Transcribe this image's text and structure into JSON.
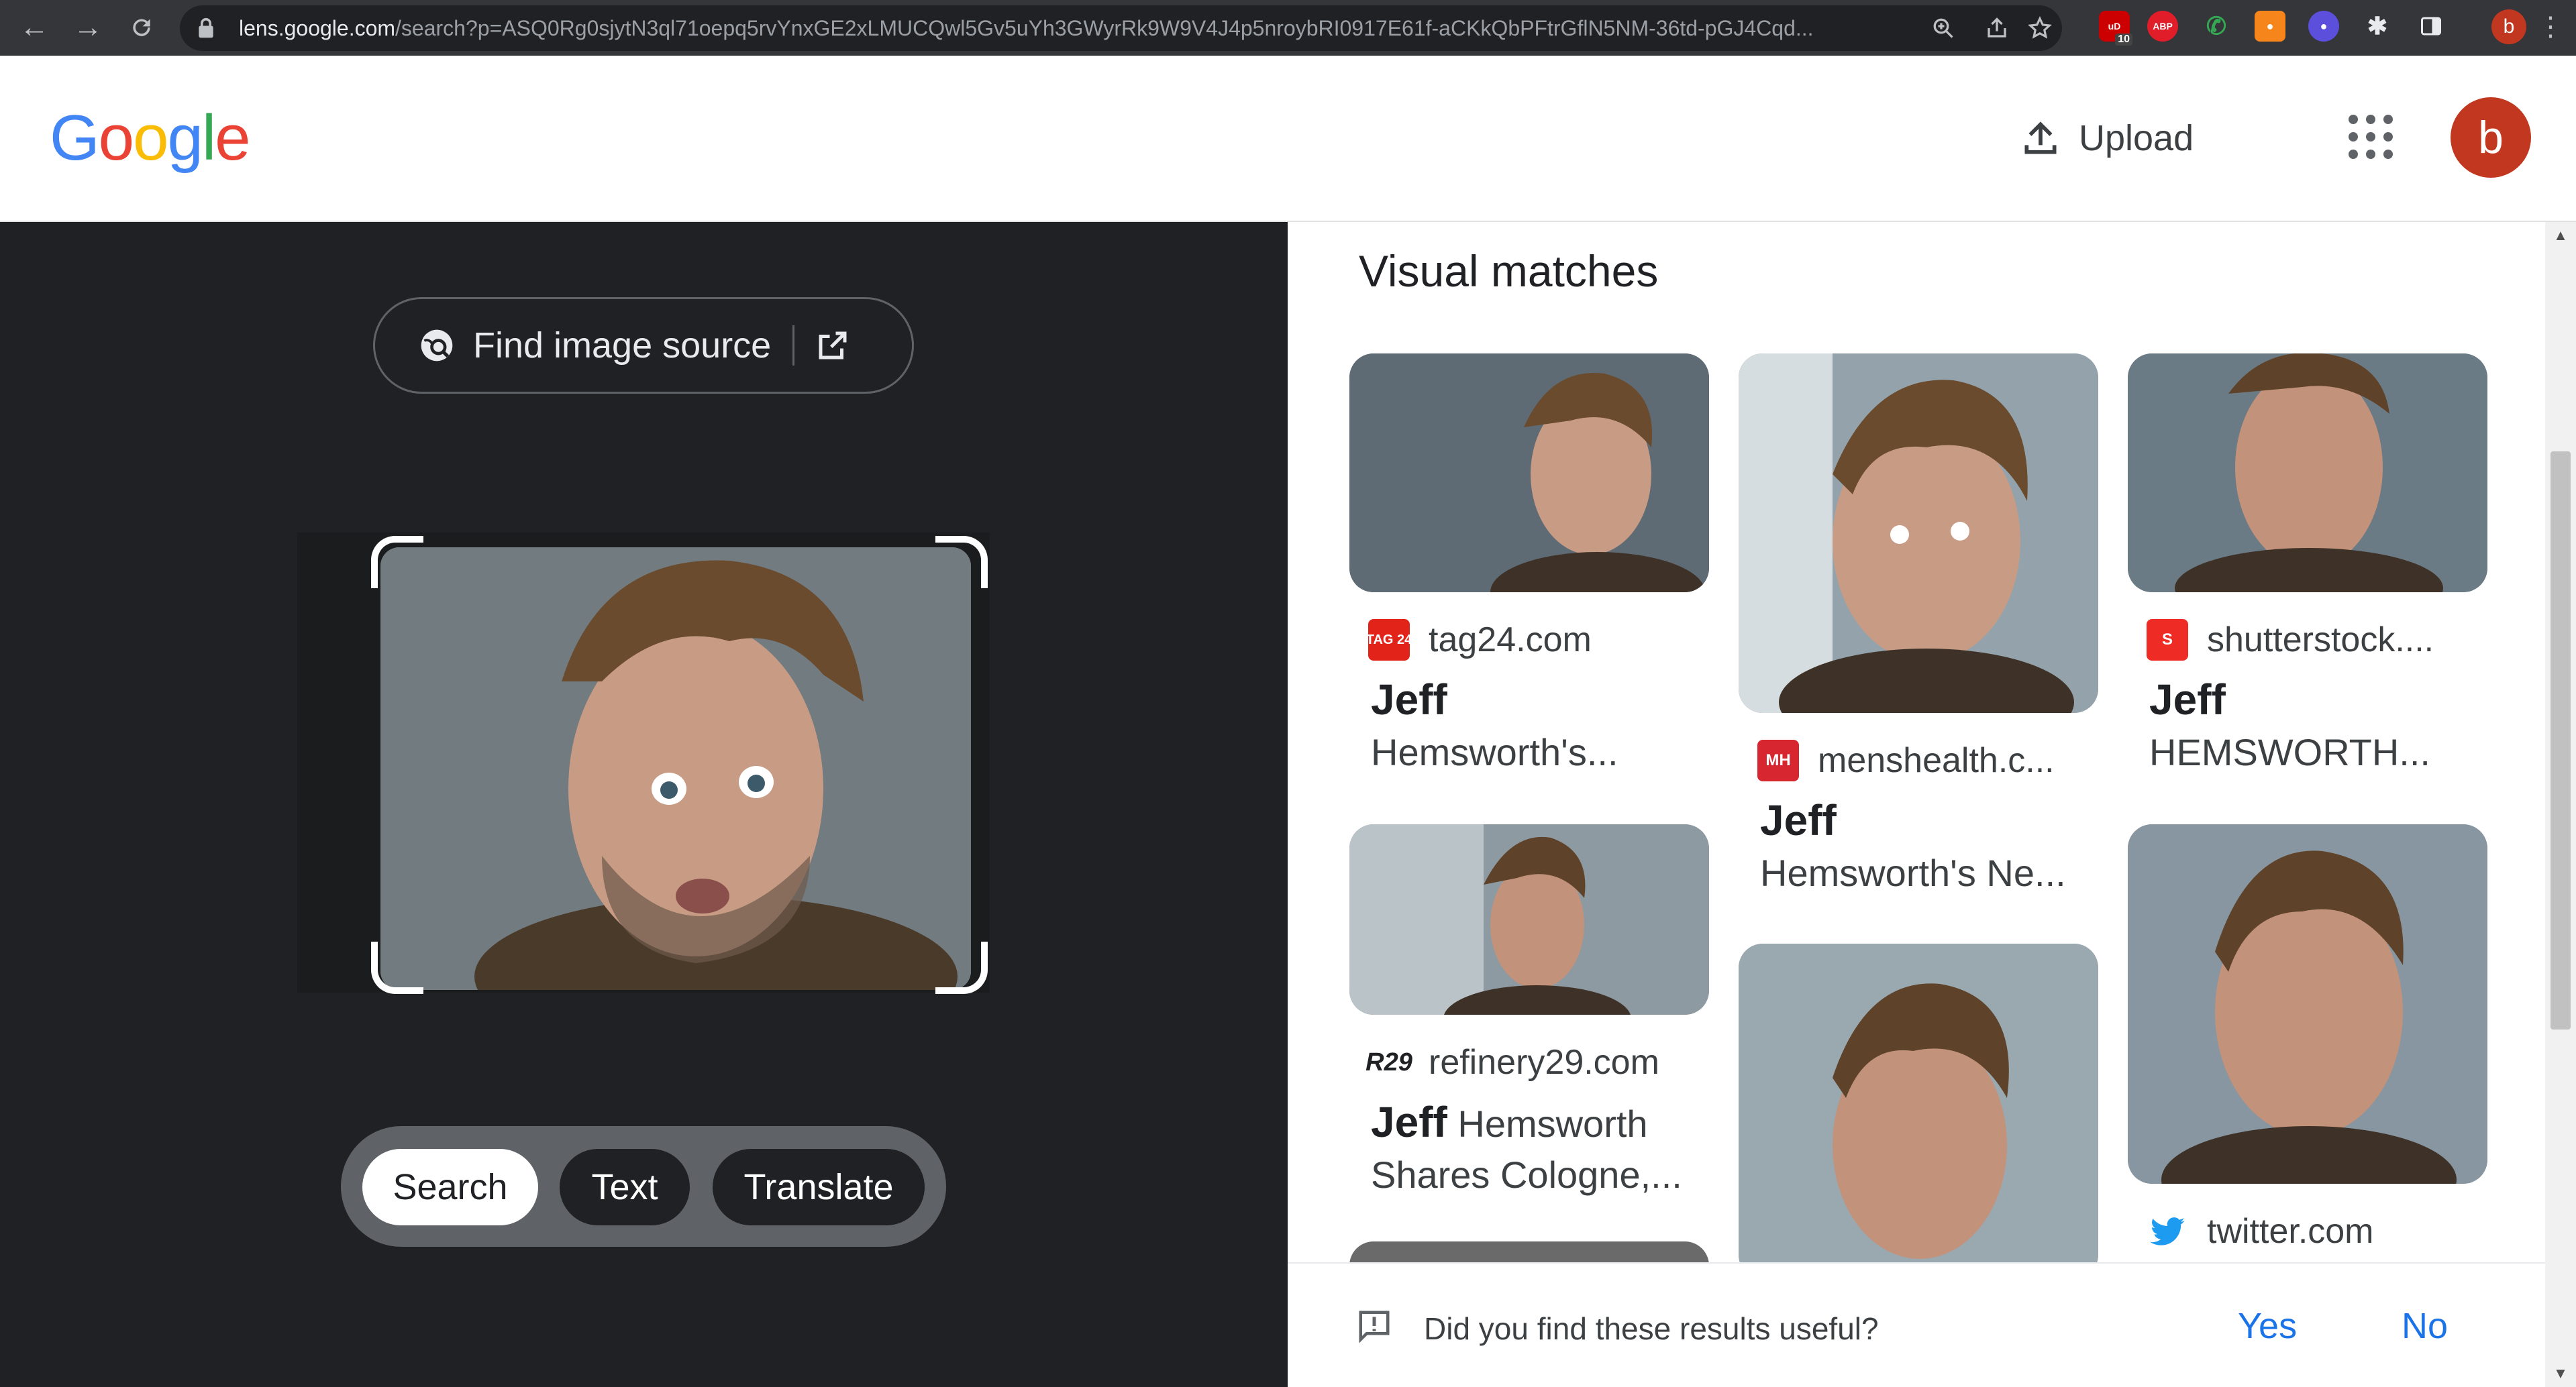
{
  "browser": {
    "url_host": "lens.google.com",
    "url_rest": "/search?p=ASQ0Rg0sjytN3ql71oepq5rvYnxGE2xLMUCQwl5Gv5uYh3GWyrRk9W9V4J4p5nroybRI0917E61f-aCKkQbPFtrGflN5NM-36td-pGJ4Cqd...",
    "ext_badge_count": "10",
    "ext_abp_label": "ABP",
    "profile_letter": "b"
  },
  "header": {
    "logo_letters": [
      "G",
      "o",
      "o",
      "g",
      "l",
      "e"
    ],
    "upload_label": "Upload",
    "account_letter": "b"
  },
  "lens": {
    "find_source_label": "Find image source",
    "modes": [
      {
        "label": "Search",
        "active": true
      },
      {
        "label": "Text",
        "active": false
      },
      {
        "label": "Translate",
        "active": false
      }
    ]
  },
  "results": {
    "title": "Visual matches",
    "items": [
      {
        "source": "tag24.com",
        "favicon_text": "TAG 24",
        "favicon_color": "#e2231a",
        "title_bold": "Jeff",
        "title_rest": "Hemsworth's..."
      },
      {
        "source": "menshealth.c...",
        "favicon_text": "MH",
        "favicon_color": "#d7262f",
        "title_bold": "Jeff",
        "title_rest": "Hemsworth's Ne..."
      },
      {
        "source": "shutterstock....",
        "favicon_text": "S",
        "favicon_color": "#ee2b24",
        "title_bold": "Jeff",
        "title_rest": "HEMSWORTH..."
      },
      {
        "source": "refinery29.com",
        "favicon_text": "R29",
        "favicon_color": "#202124",
        "title_bold": "Jeff",
        "title_rest": "Hemsworth Shares Cologne,..."
      },
      {
        "source": "twitter.com",
        "favicon_text": "twitter-icon",
        "favicon_color": "#1d9bf0"
      }
    ]
  },
  "feedback": {
    "question": "Did you find these results useful?",
    "yes_label": "Yes",
    "no_label": "No"
  }
}
